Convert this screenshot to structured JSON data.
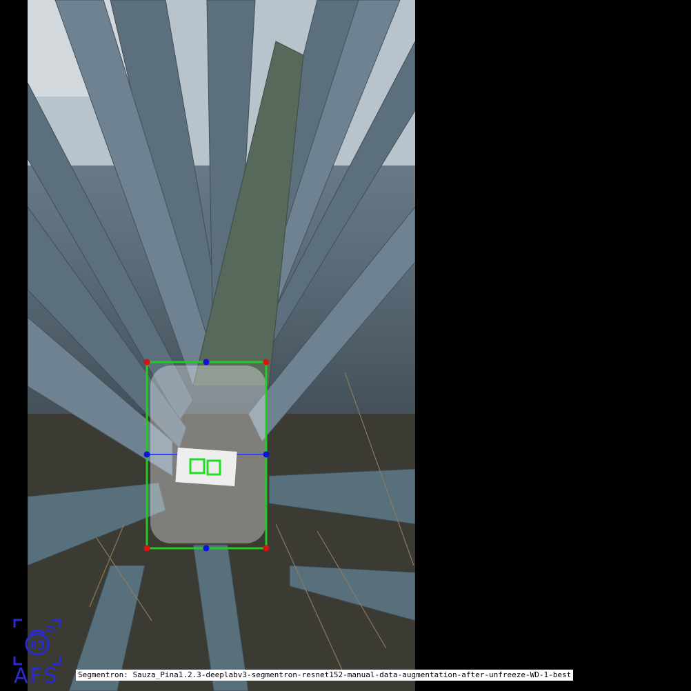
{
  "photo": {
    "subject": "agave-plant-photo"
  },
  "annotation": {
    "box_color": "#22cc22",
    "corner_color": "#dd1111",
    "midpoint_color": "#1111dd",
    "midline_color": "#3344ff",
    "mask_color": "#ffffff",
    "marker_color": "#22dd22"
  },
  "logo": {
    "icon": "agave-monitor-icon",
    "text": "AFS",
    "color": "#2a2ad6"
  },
  "caption": {
    "text": "Segmentron: Sauza_Pina1.2.3-deeplabv3-segmentron-resnet152-manual-data-augmentation-after-unfreeze-WD-1-best"
  }
}
